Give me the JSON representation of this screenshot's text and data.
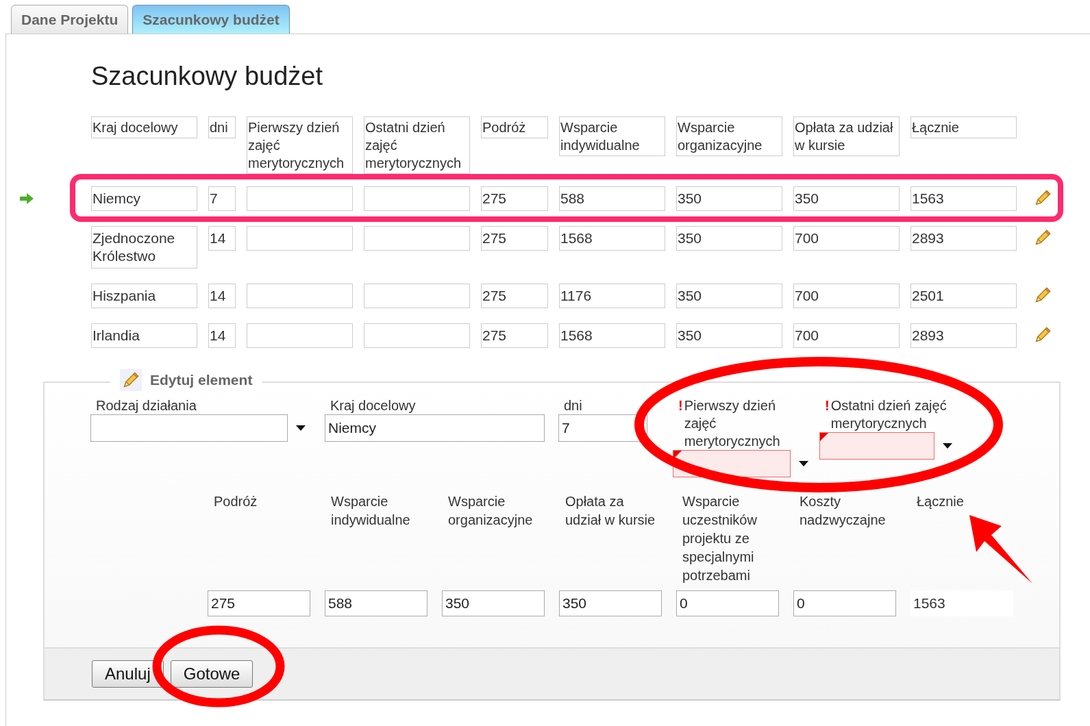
{
  "tabs": [
    {
      "label": "Dane Projektu",
      "selected": false
    },
    {
      "label": "Szacunkowy budżet",
      "selected": true
    }
  ],
  "title": "Szacunkowy budżet",
  "table": {
    "columns": [
      "Kraj docelowy",
      "dni",
      "Pierwszy dzień zajęć merytorycznych",
      "Ostatni dzień zajęć merytorycznych",
      "Podróż",
      "Wsparcie indywidualne",
      "Wsparcie organizacyjne",
      "Opłata za udział w kursie",
      "Łącznie"
    ],
    "rows": [
      {
        "current": true,
        "cells": [
          "Niemcy",
          "7",
          "",
          "",
          "275",
          "588",
          "350",
          "350",
          "1563"
        ]
      },
      {
        "current": false,
        "cells": [
          "Zjednoczone Królestwo",
          "14",
          "",
          "",
          "275",
          "1568",
          "350",
          "700",
          "2893"
        ]
      },
      {
        "current": false,
        "cells": [
          "Hiszpania",
          "14",
          "",
          "",
          "275",
          "1176",
          "350",
          "700",
          "2501"
        ]
      },
      {
        "current": false,
        "cells": [
          "Irlandia",
          "14",
          "",
          "",
          "275",
          "1568",
          "350",
          "700",
          "2893"
        ]
      }
    ]
  },
  "edit_panel": {
    "legend": "Edytuj element",
    "fields": [
      {
        "kind": "select",
        "label": "Rodzaj działania",
        "invalid": false
      },
      {
        "kind": "text",
        "label": "Kraj docelowy",
        "value": "Niemcy",
        "invalid": false
      },
      {
        "kind": "text",
        "label": "dni",
        "value": "7",
        "invalid": false
      },
      {
        "kind": "select",
        "label": "Pierwszy dzień zajęć merytorycznych",
        "marker": "!",
        "invalid": true
      },
      {
        "kind": "select",
        "label": "Ostatni dzień zajęć merytorycznych",
        "marker": "!",
        "invalid": true
      }
    ],
    "amounts": [
      {
        "kind": "text",
        "label": "Podróż",
        "value": "275"
      },
      {
        "kind": "text",
        "label": "Wsparcie indywidualne",
        "value": "588"
      },
      {
        "kind": "text",
        "label": "Wsparcie organizacyjne",
        "value": "350"
      },
      {
        "kind": "text",
        "label": "Opłata za udział w kursie",
        "value": "350"
      },
      {
        "kind": "text",
        "label": "Wsparcie uczestników projektu ze specjalnymi potrzebami",
        "value": "0"
      },
      {
        "kind": "text",
        "label": "Koszty nadzwyczajne",
        "value": "0"
      },
      {
        "kind": "readonly",
        "label": "Łącznie",
        "value": "1563"
      }
    ],
    "buttons": [
      "Anuluj",
      "Gotowe"
    ]
  }
}
